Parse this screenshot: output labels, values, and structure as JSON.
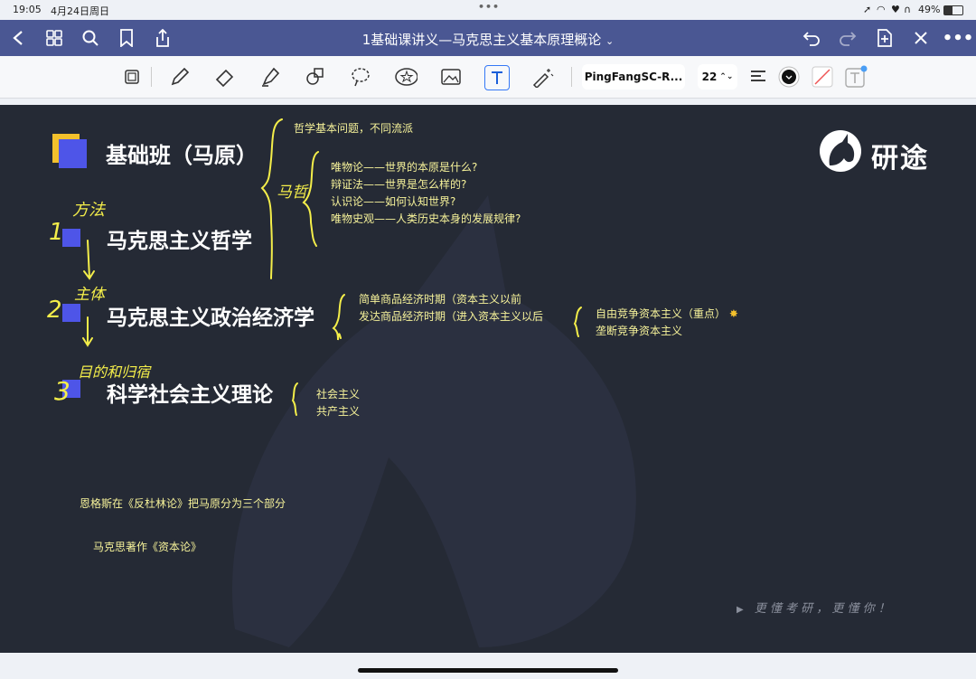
{
  "status_bar": {
    "time": "19:05",
    "date": "4月24日周日",
    "battery": "49%"
  },
  "nav": {
    "title": "1基础课讲义—马克思主义基本原理概论"
  },
  "toolbar": {
    "font": "PingFangSC-R...",
    "font_size": "22"
  },
  "slide": {
    "heading": "基础班（马原）",
    "brand": "研途",
    "sections": [
      {
        "title": "马克思主义哲学",
        "hand_number": "1",
        "hand_note": "方法"
      },
      {
        "title": "马克思主义政治经济学",
        "hand_number": "2",
        "hand_note": "主体"
      },
      {
        "title": "科学社会主义理论",
        "hand_number": "3",
        "hand_note": "目的和归宿"
      }
    ],
    "top_note": "哲学基本问题，不同流派",
    "hand_bracket_label": "马哲",
    "philosophy_notes": [
      "唯物论——世界的本原是什么?",
      "辩证法——世界是怎么样的?",
      "认识论——如何认知世界?",
      "唯物史观——人类历史本身的发展规律?"
    ],
    "economics_notes": [
      "简单商品经济时期（资本主义以前",
      "发达商品经济时期（进入资本主义以后"
    ],
    "capitalism_notes": [
      "自由竞争资本主义（重点）",
      "垄断竞争资本主义"
    ],
    "socialism_notes": [
      "社会主义",
      "共产主义"
    ],
    "footer_note_1": "恩格斯在《反杜林论》把马原分为三个部分",
    "footer_note_2": "马克思著作《资本论》",
    "slogan": "更 懂 考 研 ， 更 懂 你 ！"
  },
  "colors": {
    "nav": "#4a5793",
    "slide_bg": "#252a35",
    "accent_blue": "#4e55e8",
    "accent_yellow": "#f3c02c",
    "note": "#f7f39a"
  }
}
